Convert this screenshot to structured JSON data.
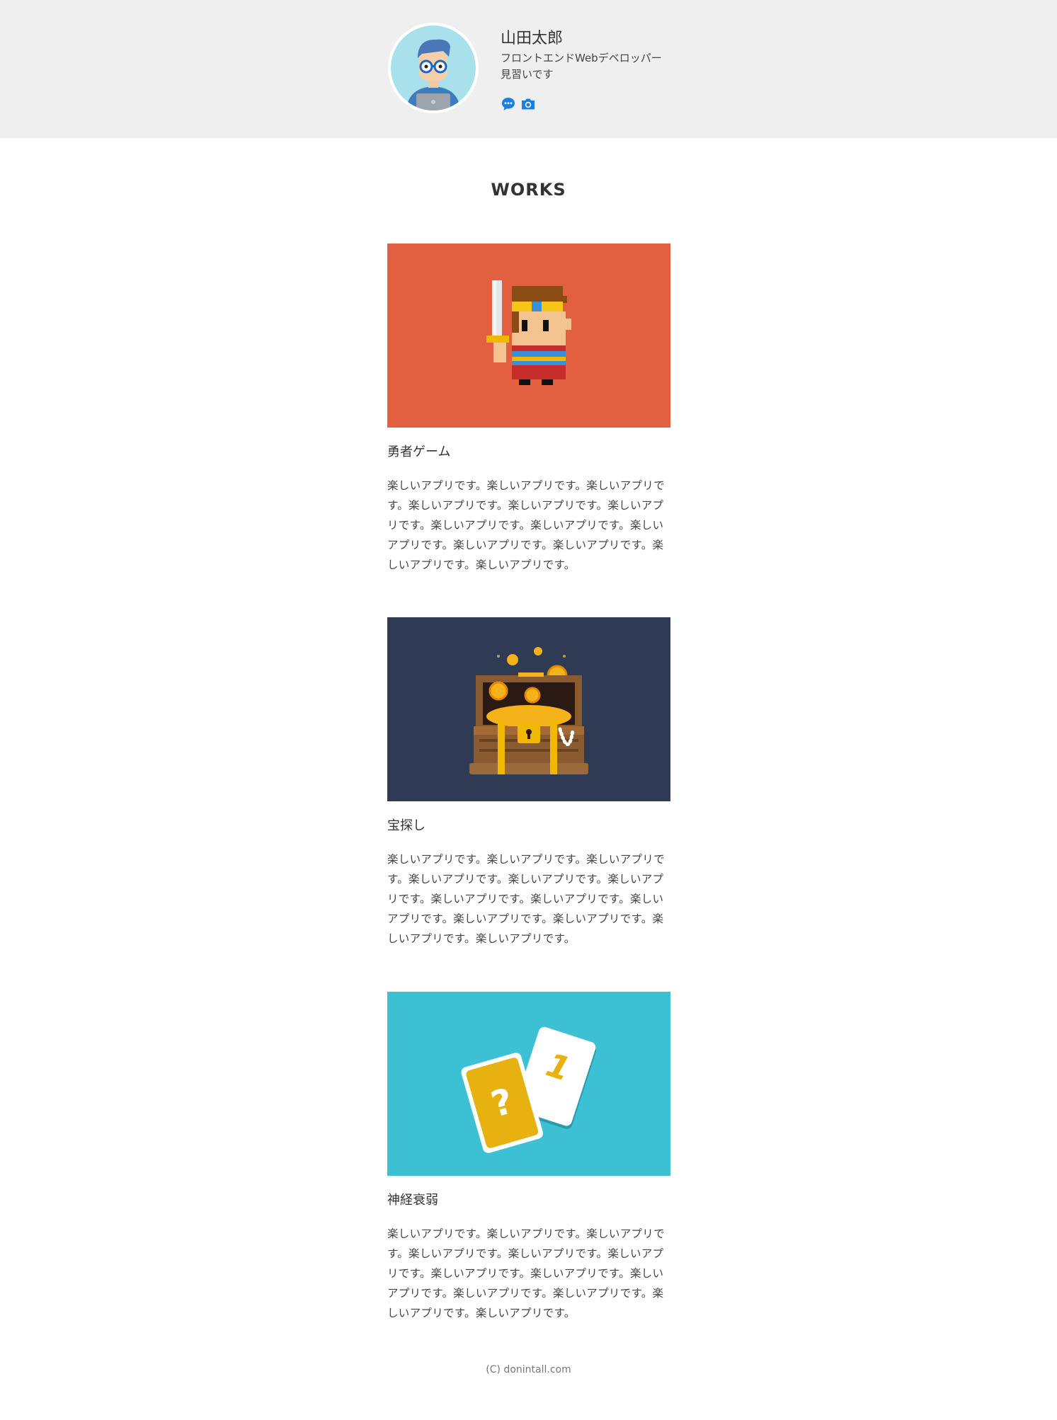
{
  "profile": {
    "name": "山田太郎",
    "bio": "フロントエンドWebデベロッパー見習いです",
    "social_icons": [
      "chat-bubble-icon",
      "camera-icon"
    ],
    "icon_color": "#1a7fe0"
  },
  "section_title": "WORKS",
  "works": [
    {
      "title": "勇者ゲーム",
      "image_bg": "#e2603f",
      "image_icon": "pixel-hero-icon",
      "description": "楽しいアプリです。楽しいアプリです。楽しいアプリです。楽しいアプリです。楽しいアプリです。楽しいアプリです。楽しいアプリです。楽しいアプリです。楽しいアプリです。楽しいアプリです。楽しいアプリです。楽しいアプリです。楽しいアプリです。"
    },
    {
      "title": "宝探し",
      "image_bg": "#2f3a54",
      "image_icon": "treasure-chest-icon",
      "description": "楽しいアプリです。楽しいアプリです。楽しいアプリです。楽しいアプリです。楽しいアプリです。楽しいアプリです。楽しいアプリです。楽しいアプリです。楽しいアプリです。楽しいアプリです。楽しいアプリです。楽しいアプリです。楽しいアプリです。"
    },
    {
      "title": "神経衰弱",
      "image_bg": "#3cc0d4",
      "image_icon": "playing-cards-icon",
      "description": "楽しいアプリです。楽しいアプリです。楽しいアプリです。楽しいアプリです。楽しいアプリです。楽しいアプリです。楽しいアプリです。楽しいアプリです。楽しいアプリです。楽しいアプリです。楽しいアプリです。楽しいアプリです。楽しいアプリです。"
    }
  ],
  "footer": "(C) donintall.com"
}
